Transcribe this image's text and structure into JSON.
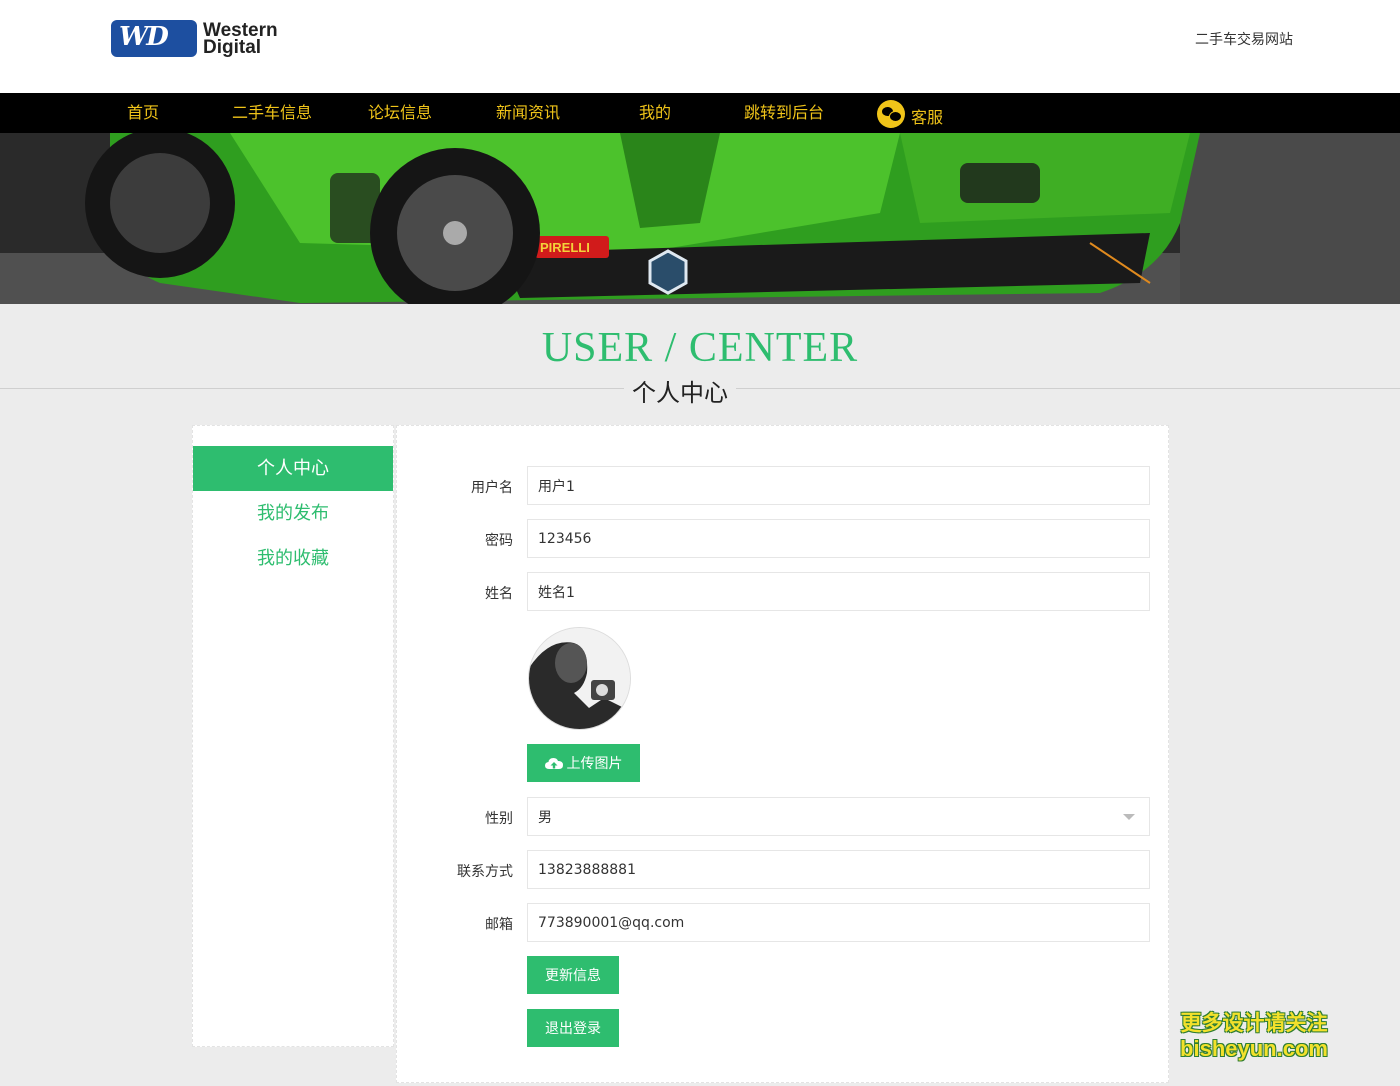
{
  "header": {
    "logo_line1": "Western",
    "logo_line2": "Digital",
    "logo_badge": "WD",
    "site_name": "二手车交易网站"
  },
  "nav": {
    "items": [
      "首页",
      "二手车信息",
      "论坛信息",
      "新闻资讯",
      "我的",
      "跳转到后台"
    ],
    "service_label": "客服"
  },
  "title": {
    "en": "USER / CENTER",
    "cn": "个人中心"
  },
  "sidebar": {
    "items": [
      "个人中心",
      "我的发布",
      "我的收藏"
    ],
    "active": "个人中心"
  },
  "form": {
    "username_label": "用户名",
    "username_value": "用户1",
    "password_label": "密码",
    "password_value": "123456",
    "name_label": "姓名",
    "name_value": "姓名1",
    "upload_label": "上传图片",
    "gender_label": "性别",
    "gender_value": "男",
    "phone_label": "联系方式",
    "phone_value": "13823888881",
    "email_label": "邮箱",
    "email_value": "773890001@qq.com",
    "update_label": "更新信息",
    "logout_label": "退出登录"
  },
  "watermark": {
    "line1": "更多设计请关注",
    "line2": "bisheyun.com"
  },
  "colors": {
    "accent": "#2ebd6f",
    "nav_text": "#f0c419",
    "nav_bg": "#000000",
    "logo_blue": "#1d4fa0"
  }
}
